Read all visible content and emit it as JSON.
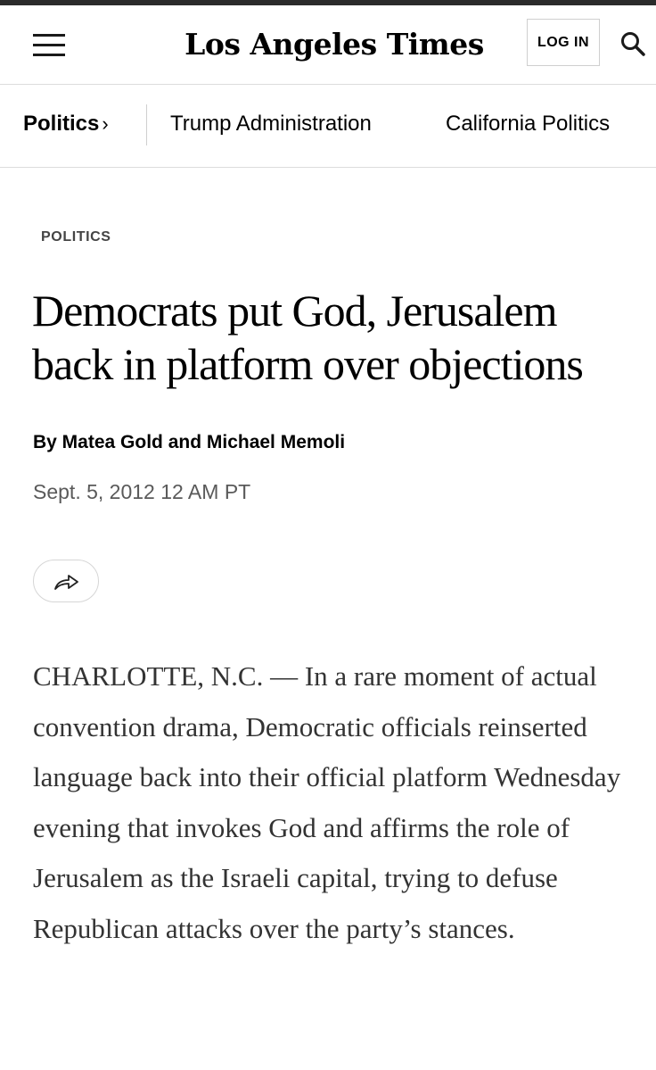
{
  "header": {
    "logo_text": "Los Angeles Times",
    "login_label": "LOG IN"
  },
  "subnav": {
    "section": "Politics",
    "section_chevron": "›",
    "links": [
      "Trump Administration",
      "California Politics"
    ]
  },
  "article": {
    "kicker": "POLITICS",
    "headline": "Democrats put God, Jerusalem back in platform over objections",
    "byline": "By Matea Gold and Michael Memoli",
    "date": "Sept. 5, 2012 12 AM PT",
    "body": "CHARLOTTE, N.C. — In a rare moment of actual convention drama, Democratic officials reinserted language back into their official platform Wednesday evening that invokes God and affirms the role of Jerusalem as the Israeli capital, trying to defuse Republican attacks over the party’s stances."
  },
  "icons": {
    "menu": "hamburger-menu-icon",
    "search": "search-icon",
    "share": "share-arrow-icon"
  }
}
